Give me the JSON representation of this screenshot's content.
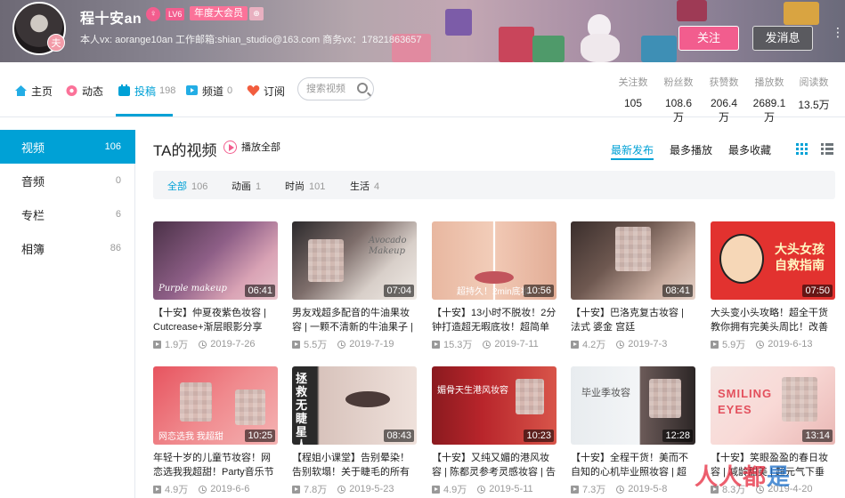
{
  "banner": {
    "user_name": "程十安an",
    "gender_glyph": "♀",
    "level": "LV6",
    "vip": "年度大会员",
    "extra_badge": "⊕",
    "signature": "本人vx: aorange10an  工作邮箱:shian_studio@163.com  商务vx：17821863657",
    "avatar_badge": "夫",
    "follow_label": "关注",
    "message_label": "发消息",
    "more_glyph": "⋮"
  },
  "nav": {
    "home": "主页",
    "dynamic": "动态",
    "contrib": "投稿",
    "contrib_count": "198",
    "channel": "频道",
    "channel_count": "0",
    "subscribe": "订阅",
    "search_placeholder": "搜索视频"
  },
  "stats": [
    {
      "label": "关注数",
      "value": "105"
    },
    {
      "label": "粉丝数",
      "value": "108.6万"
    },
    {
      "label": "获赞数",
      "value": "206.4万"
    },
    {
      "label": "播放数",
      "value": "2689.1万"
    },
    {
      "label": "阅读数",
      "value": "13.5万"
    }
  ],
  "sidebar": {
    "items": [
      {
        "label": "视频",
        "count": "106"
      },
      {
        "label": "音频",
        "count": "0"
      },
      {
        "label": "专栏",
        "count": "6"
      },
      {
        "label": "相簿",
        "count": "86"
      }
    ]
  },
  "main": {
    "title": "TA的视频",
    "play_all": "播放全部",
    "sort": {
      "latest": "最新发布",
      "most_play": "最多播放",
      "most_fav": "最多收藏"
    },
    "filters": [
      {
        "label": "全部",
        "count": "106"
      },
      {
        "label": "动画",
        "count": "1"
      },
      {
        "label": "时尚",
        "count": "101"
      },
      {
        "label": "生活",
        "count": "4"
      }
    ]
  },
  "videos": [
    {
      "duration": "06:41",
      "title": "【十安】仲夏夜紫色妆容 | Cutcrease+渐层眼影分享",
      "views": "1.9万",
      "date": "2019-7-26",
      "thumb_text": "Purple makeup"
    },
    {
      "duration": "07:04",
      "title": "男友戏超多配音的牛油果妆容 | 一颗不清新的牛油果子 |",
      "views": "5.5万",
      "date": "2019-7-19",
      "thumb_text": "Avocado Makeup"
    },
    {
      "duration": "10:56",
      "title": "【十安】13小时不脱妆！2分钟打造超无暇底妆！超简单的",
      "views": "15.3万",
      "date": "2019-7-11",
      "thumb_text": "超持久！2min底妆"
    },
    {
      "duration": "08:41",
      "title": "【十安】巴洛克复古妆容 | 法式 婆金 宫廷",
      "views": "4.2万",
      "date": "2019-7-3",
      "thumb_text": ""
    },
    {
      "duration": "07:50",
      "title": "大头变小头攻略！超全干货教你拥有完美头周比！改善头大",
      "views": "5.9万",
      "date": "2019-6-13",
      "thumb_text": "大头女孩 自救指南"
    },
    {
      "duration": "10:25",
      "title": "年轻十岁的儿童节妆容！网恋选我我超甜！Party音乐节必",
      "views": "4.9万",
      "date": "2019-6-6",
      "thumb_text": "网恋选我 我超甜"
    },
    {
      "duration": "08:43",
      "title": "【程姐小课堂】告别晕染！告别软塌！关于睫毛的所有问题",
      "views": "7.8万",
      "date": "2019-5-23",
      "thumb_text": "拯救无睫星人"
    },
    {
      "duration": "10:23",
      "title": "【十安】又纯又媚的港风妆容 | 陈都灵参考灵感妆容 | 告别",
      "views": "4.9万",
      "date": "2019-5-11",
      "thumb_text": "媚骨天生港风妆容"
    },
    {
      "duration": "12:28",
      "title": "【十安】全程干货！美而不自知的心机毕业照妆容 | 超实用",
      "views": "7.3万",
      "date": "2019-5-8",
      "thumb_text": "毕业季妆容"
    },
    {
      "duration": "13:14",
      "title": "【十安】笑眼盈盈的春日妆容 | 减龄甜美 | 超元气下垂",
      "views": "8.3万",
      "date": "2019-4-20",
      "thumb_text": "SMILING EYES"
    }
  ],
  "watermark": {
    "a": "人人都",
    "b": "是"
  },
  "colors": {
    "accent": "#00a1d6",
    "pink": "#f25d8e"
  }
}
